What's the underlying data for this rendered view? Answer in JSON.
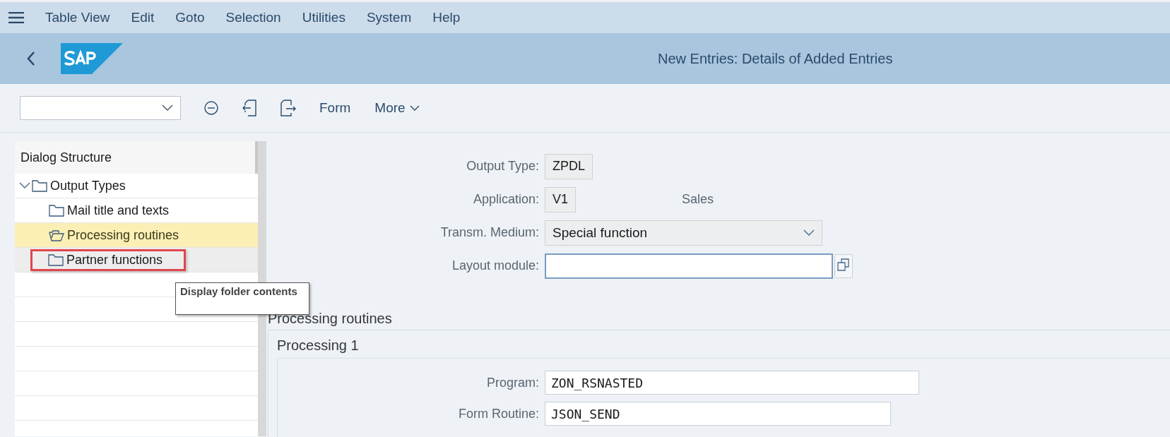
{
  "menu_bar": {
    "items": [
      "Table View",
      "Edit",
      "Goto",
      "Selection",
      "Utilities",
      "System",
      "Help"
    ]
  },
  "header": {
    "title": "New Entries: Details of Added Entries"
  },
  "toolbar": {
    "buttons": [
      "Form",
      "More"
    ]
  },
  "dialog_structure": {
    "title": "Dialog Structure",
    "tree": [
      {
        "label": "Output Types",
        "expanded": true,
        "selected": false,
        "hovered": false,
        "highlighted": false,
        "children": [
          {
            "label": "Mail title and texts",
            "selected": false,
            "hovered": false,
            "highlighted": false
          },
          {
            "label": "Processing routines",
            "selected": true,
            "hovered": false,
            "highlighted": false
          },
          {
            "label": "Partner functions",
            "selected": false,
            "hovered": true,
            "highlighted": true
          }
        ]
      }
    ]
  },
  "tooltip": {
    "text": "Display folder contents"
  },
  "header_fields": [
    {
      "kind": "display",
      "label": "Output Type:",
      "value": "ZPDL"
    },
    {
      "kind": "display",
      "label": "Application:",
      "value": "V1",
      "description": "Sales"
    },
    {
      "kind": "dropdown",
      "label": "Transm. Medium:",
      "value": "Special function"
    },
    {
      "kind": "input",
      "label": "Layout module:",
      "focused": true
    }
  ],
  "section": {
    "title": "Processing routines",
    "group_title": "Processing 1",
    "fields": [
      {
        "label": "Program:",
        "value": "ZON_RSNASTED",
        "kind": "wide"
      },
      {
        "label": "Form Routine:",
        "value": "JSON_SEND",
        "kind": "normal"
      }
    ]
  }
}
